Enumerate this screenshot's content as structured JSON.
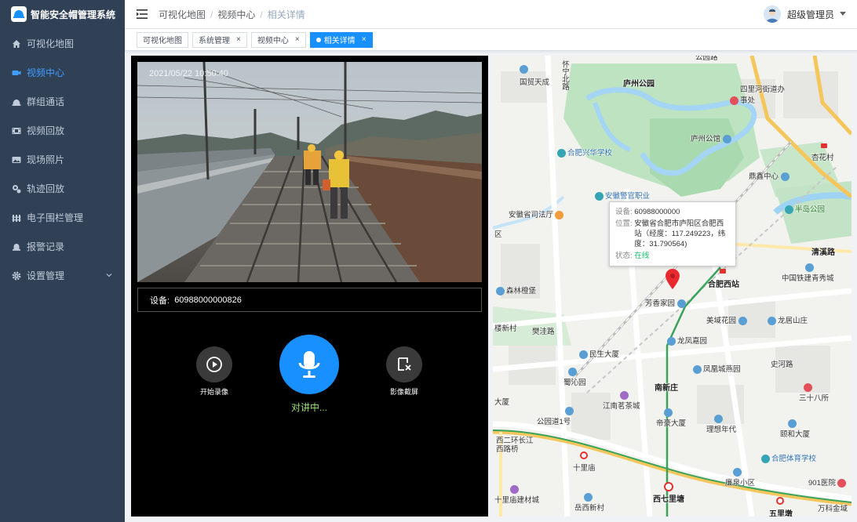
{
  "app": {
    "title": "智能安全帽管理系统"
  },
  "sidebar": {
    "items": [
      {
        "label": "可视化地图",
        "icon": "home-icon"
      },
      {
        "label": "视频中心",
        "icon": "video-icon",
        "active": true
      },
      {
        "label": "群组通话",
        "icon": "group-icon"
      },
      {
        "label": "视频回放",
        "icon": "film-icon"
      },
      {
        "label": "现场照片",
        "icon": "photo-icon"
      },
      {
        "label": "轨迹回放",
        "icon": "track-icon"
      },
      {
        "label": "电子围栏管理",
        "icon": "fence-icon"
      },
      {
        "label": "报警记录",
        "icon": "alarm-icon"
      },
      {
        "label": "设置管理",
        "icon": "gear-icon"
      }
    ]
  },
  "header": {
    "breadcrumb": [
      "可视化地图",
      "视频中心",
      "相关详情"
    ],
    "user": "超级管理员"
  },
  "tags": [
    {
      "label": "可视化地图",
      "closable": false
    },
    {
      "label": "系统管理",
      "closable": true
    },
    {
      "label": "视频中心",
      "closable": true
    },
    {
      "label": "相关详情",
      "closable": true,
      "active": true
    }
  ],
  "video": {
    "timestamp": "2021/05/22 10:50:40",
    "device_label": "设备:",
    "device_id": "60988000000826",
    "record_label": "开始录像",
    "screenshot_label": "影像截屏",
    "talk_status": "对讲中..."
  },
  "map": {
    "popup": {
      "device_key": "设备:",
      "device_value": "60988000000",
      "location_key": "位置:",
      "location_value": "安徽省合肥市庐阳区合肥西站（经度：117.249223，纬度：31.790564)",
      "status_key": "状态:",
      "status_value": "在线"
    },
    "labels": {
      "l1": "公园路",
      "l2": "国贸天成",
      "l3": "怀宁北路",
      "l4": "庐州公园",
      "l5": "四里河街道办事处",
      "l6": "合肥兴华学校",
      "l7": "庐州公馆",
      "l8": "杏花村",
      "l9": "鼎鑫中心",
      "l10": "安徽警官职业",
      "l11": "安徽省司法厅",
      "l12": "半岛公园",
      "l13": "清溪路",
      "l14": "合肥西站",
      "l15": "中国铁建青秀城",
      "l16": "森林橙堡",
      "l17": "芳香家园",
      "l18": "美域花园",
      "l19": "龙居山庄",
      "l20": "樊洼路",
      "l21": "楼新村",
      "l22": "龙凤嘉园",
      "l23": "民生大厦",
      "l24": "凤凰城燕园",
      "l25": "史河路",
      "l26": "蜀沁园",
      "l27": "南新庄",
      "l28": "江南茗茶城",
      "l29": "三十八所",
      "l30": "大厦",
      "l31": "公园道1号",
      "l32": "帝豪大厦",
      "l33": "理想年代",
      "l34": "颐和大厦",
      "l35": "西二环长江西路桥",
      "l36": "合肥体育学校",
      "l37": "十里庙",
      "l38": "廉泉小区",
      "l39": "901医院",
      "l40": "西七里塘",
      "l41": "十里庙建材城",
      "l42": "岳西新村",
      "l43": "五里墩",
      "l44": "万科金域",
      "l45": "区"
    }
  },
  "colors": {
    "sidebar_bg": "#304156",
    "accent": "#1890ff",
    "online": "#19be6b"
  }
}
